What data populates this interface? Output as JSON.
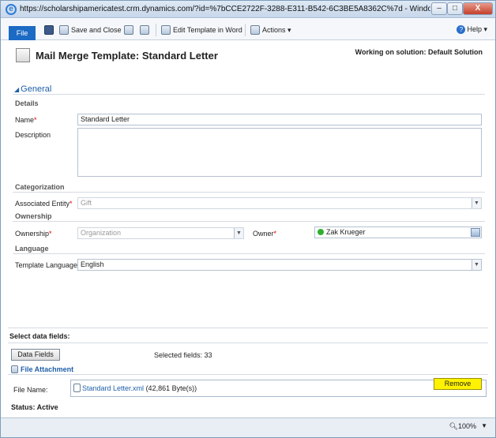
{
  "browser": {
    "title": "https://scholarshipamericatest.crm.dynamics.com/?id=%7bCCE2722F-3288-E311-B542-6C3BE5A8362C%7d - Windows Internet E...",
    "minimize": "–",
    "maximize": "□",
    "close": "X"
  },
  "ribbon": {
    "file": "File",
    "save_close": "Save and Close",
    "edit_template": "Edit Template in Word",
    "actions": "Actions ▾",
    "help": "Help ▾"
  },
  "header": {
    "title": "Mail Merge Template: Standard Letter",
    "solution": "Working on solution: Default Solution"
  },
  "section": {
    "general": "General",
    "details": "Details",
    "name_label": "Name",
    "name_value": "Standard Letter",
    "description_label": "Description",
    "description_value": "",
    "categorization": "Categorization",
    "assoc_label": "Associated Entity",
    "assoc_value": "Gift",
    "ownership_group": "Ownership",
    "ownership_label": "Ownership",
    "ownership_value": "Organization",
    "owner_label": "Owner",
    "owner_value": "Zak Krueger",
    "language_group": "Language",
    "template_lang_label": "Template Language",
    "template_lang_value": "English",
    "required_mark": "*"
  },
  "bottom": {
    "select_fields": "Select data fields:",
    "data_fields_btn": "Data Fields",
    "selected_fields": "Selected fields: 33",
    "file_attachment": "File Attachment",
    "file_name_label": "File Name:",
    "file_link": "Standard Letter.xml",
    "file_size": "(42,861 Byte(s))",
    "remove": "Remove",
    "status": "Status: Active"
  },
  "statusbar": {
    "zoom": "100%"
  }
}
